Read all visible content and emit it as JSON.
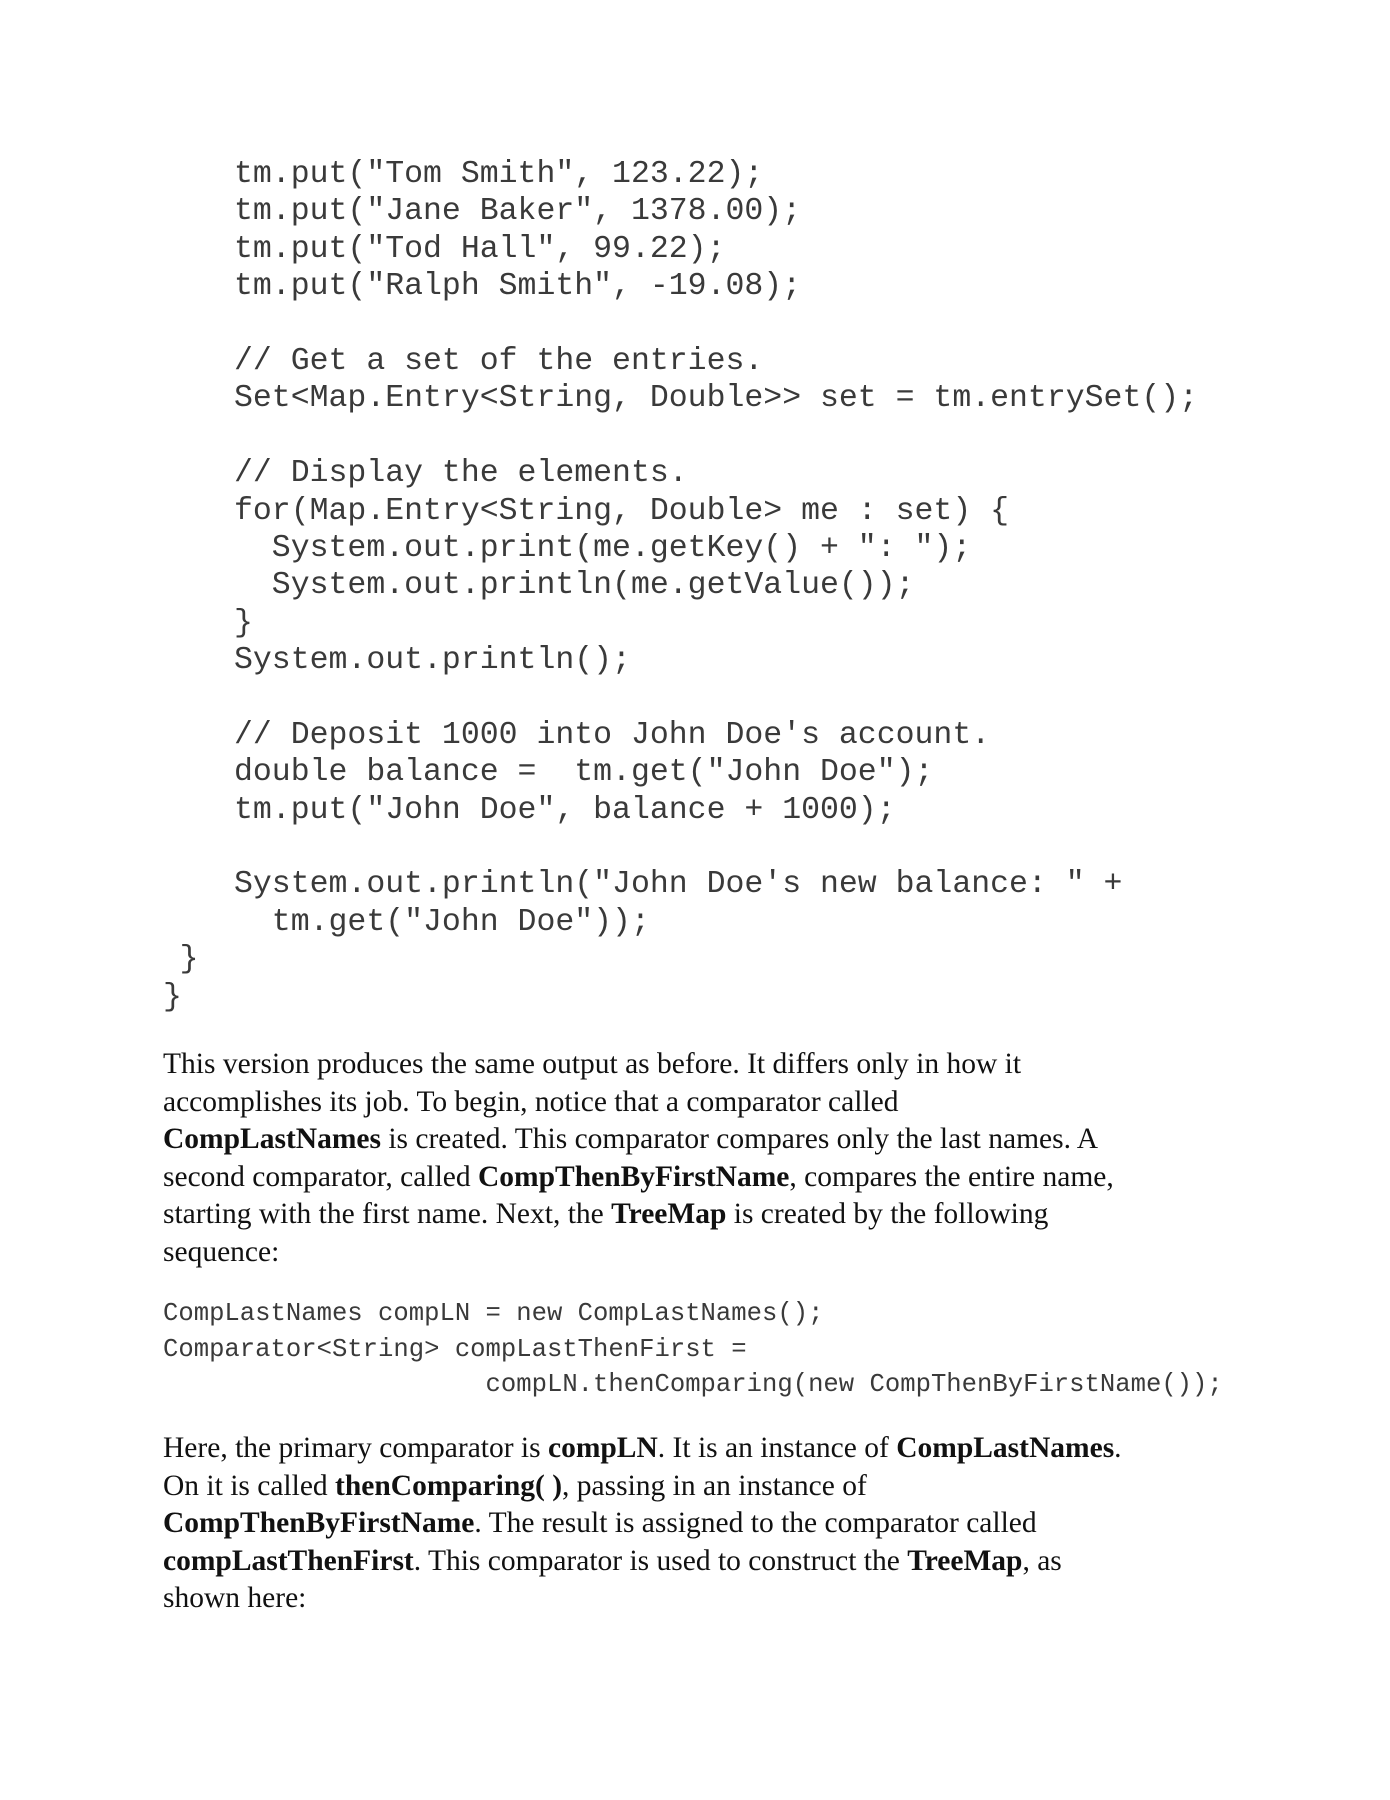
{
  "code_block_1": [
    "tm.put(\"Tom Smith\", 123.22);",
    "tm.put(\"Jane Baker\", 1378.00);",
    "tm.put(\"Tod Hall\", 99.22);",
    "tm.put(\"Ralph Smith\", -19.08);",
    "",
    "// Get a set of the entries.",
    "Set<Map.Entry<String, Double>> set = tm.entrySet();",
    "",
    "// Display the elements.",
    "for(Map.Entry<String, Double> me : set) {",
    "  System.out.print(me.getKey() + \": \");",
    "  System.out.println(me.getValue());",
    "}",
    "System.out.println();",
    "",
    "// Deposit 1000 into John Doe's account.",
    "double balance =  tm.get(\"John Doe\");",
    "tm.put(\"John Doe\", balance + 1000);",
    "",
    "System.out.println(\"John Doe's new balance: \" +",
    "  tm.get(\"John Doe\"));",
    "    }",
    "}"
  ],
  "paragraph_1": [
    [
      {
        "t": "This version produces the same output as before. It differs only in how it"
      }
    ],
    [
      {
        "t": "accomplishes its job. To begin, notice that a comparator called"
      }
    ],
    [
      {
        "t": "CompLastNames",
        "b": true
      },
      {
        "t": " is created. This comparator compares only the last names. A"
      }
    ],
    [
      {
        "t": "second comparator, called "
      },
      {
        "t": "CompThenByFirstName",
        "b": true
      },
      {
        "t": ", compares the entire name,"
      }
    ],
    [
      {
        "t": "starting with the first name. Next, the "
      },
      {
        "t": "TreeMap",
        "b": true
      },
      {
        "t": " is created by the following"
      }
    ],
    [
      {
        "t": "sequence:"
      }
    ]
  ],
  "code_block_2": [
    "CompLastNames compLN = new CompLastNames();",
    "Comparator<String> compLastThenFirst =",
    "                     compLN.thenComparing(new CompThenByFirstName());"
  ],
  "paragraph_2": [
    [
      {
        "t": "Here, the primary comparator is "
      },
      {
        "t": "compLN",
        "b": true
      },
      {
        "t": ". It is an instance of "
      },
      {
        "t": "CompLastNames",
        "b": true
      },
      {
        "t": "."
      }
    ],
    [
      {
        "t": "On it is called "
      },
      {
        "t": "thenComparing( )",
        "b": true
      },
      {
        "t": ", passing in an instance of"
      }
    ],
    [
      {
        "t": "CompThenByFirstName",
        "b": true
      },
      {
        "t": ". The result is assigned to the comparator called"
      }
    ],
    [
      {
        "t": "compLastThenFirst",
        "b": true
      },
      {
        "t": ". This comparator is used to construct the "
      },
      {
        "t": "TreeMap",
        "b": true
      },
      {
        "t": ", as"
      }
    ],
    [
      {
        "t": "shown here:"
      }
    ]
  ]
}
